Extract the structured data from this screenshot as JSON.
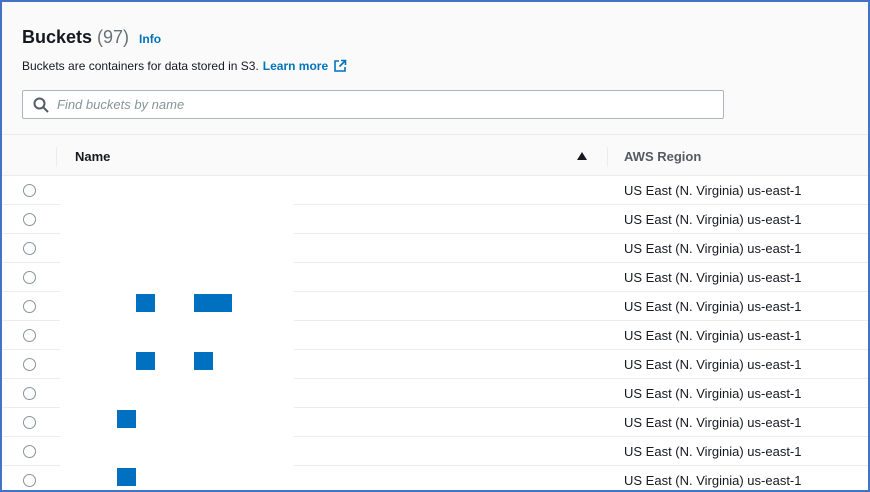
{
  "header": {
    "title": "Buckets",
    "count": "(97)",
    "info": "Info",
    "description": "Buckets are containers for data stored in S3.",
    "learn_more": "Learn more"
  },
  "search": {
    "placeholder": "Find buckets by name"
  },
  "table": {
    "columns": {
      "name": "Name",
      "region": "AWS Region"
    },
    "sort_icon": "sort-ascending-icon",
    "rows": [
      {
        "region": "US East (N. Virginia) us-east-1"
      },
      {
        "region": "US East (N. Virginia) us-east-1"
      },
      {
        "region": "US East (N. Virginia) us-east-1"
      },
      {
        "region": "US East (N. Virginia) us-east-1"
      },
      {
        "region": "US East (N. Virginia) us-east-1"
      },
      {
        "region": "US East (N. Virginia) us-east-1"
      },
      {
        "region": "US East (N. Virginia) us-east-1"
      },
      {
        "region": "US East (N. Virginia) us-east-1"
      },
      {
        "region": "US East (N. Virginia) us-east-1"
      },
      {
        "region": "US East (N. Virginia) us-east-1"
      },
      {
        "region": "US East (N. Virginia) us-east-1"
      }
    ]
  },
  "colors": {
    "link": "#0073bb",
    "redaction": "#0070c0",
    "frame": "#4472c4"
  }
}
